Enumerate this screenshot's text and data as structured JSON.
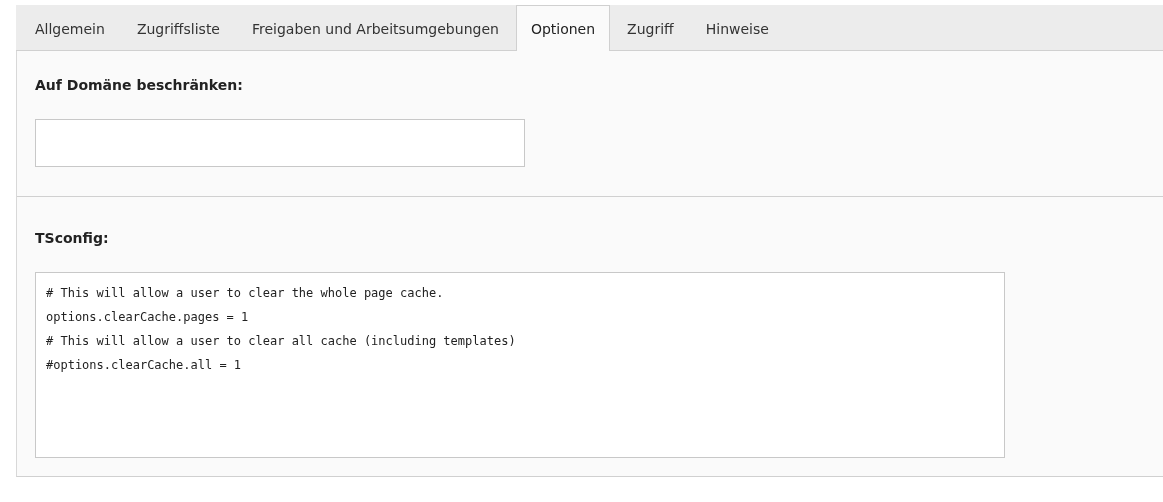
{
  "tabs": [
    {
      "label": "Allgemein",
      "selected": false
    },
    {
      "label": "Zugriffsliste",
      "selected": false
    },
    {
      "label": "Freigaben und Arbeitsumgebungen",
      "selected": false
    },
    {
      "label": "Optionen",
      "selected": true
    },
    {
      "label": "Zugriff",
      "selected": false
    },
    {
      "label": "Hinweise",
      "selected": false
    }
  ],
  "domain": {
    "label": "Auf Domäne beschränken:"
  },
  "tsconfig": {
    "label": "TSconfig:",
    "value": "# This will allow a user to clear the whole page cache.\noptions.clearCache.pages = 1\n# This will allow a user to clear all cache (including templates)\n#options.clearCache.all = 1"
  }
}
